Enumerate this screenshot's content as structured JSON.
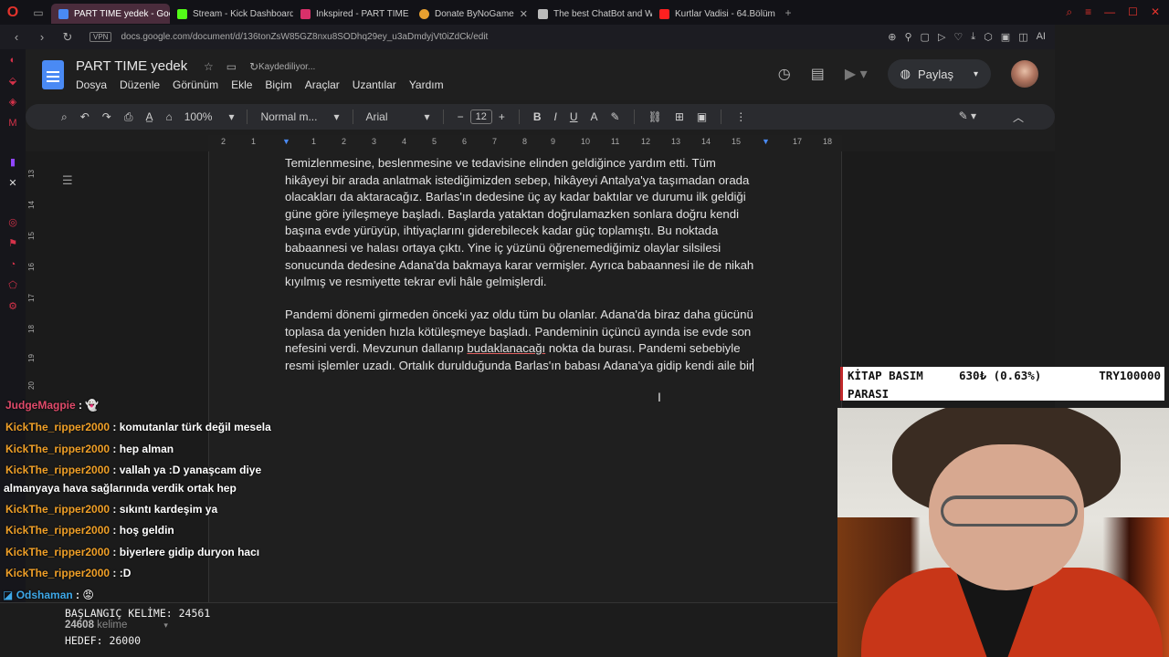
{
  "browser": {
    "tabs": [
      {
        "label": "PART TIME yedek - Goog",
        "color": "#4a8af4",
        "active": true
      },
      {
        "label": "Stream - Kick Dashboard",
        "color": "#53fc18",
        "active": false
      },
      {
        "label": "Inkspired - PART TIME",
        "color": "#d9306a",
        "active": false
      },
      {
        "label": "Donate ByNoGame",
        "color": "#e8a030",
        "active": false
      },
      {
        "label": "The best ChatBot and Wid",
        "color": "#bbbbbb",
        "active": false
      },
      {
        "label": "Kurtlar Vadisi - 64.Bölüm",
        "color": "#ff2020",
        "active": false
      }
    ],
    "url": "docs.google.com/document/d/136tonZsW85GZ8nxu8SODhq29ey_u3aDmdyjVt0iZdCk/edit",
    "vpn_label": "VPN",
    "ai_label": "AI"
  },
  "docs": {
    "title": "PART TIME  yedek",
    "saving_status": "Kaydediliyor...",
    "menu": [
      "Dosya",
      "Düzenle",
      "Görünüm",
      "Ekle",
      "Biçim",
      "Araçlar",
      "Uzantılar",
      "Yardım"
    ],
    "share_label": "Paylaş",
    "toolbar": {
      "zoom": "100%",
      "style": "Normal m...",
      "font": "Arial",
      "font_size": "12"
    },
    "ruler_h": [
      "2",
      "1",
      "1",
      "2",
      "3",
      "4",
      "5",
      "6",
      "7",
      "8",
      "9",
      "10",
      "11",
      "12",
      "13",
      "14",
      "15",
      "16",
      "17",
      "18"
    ],
    "ruler_v": [
      "13",
      "14",
      "15",
      "16",
      "17",
      "18",
      "19",
      "20"
    ],
    "paragraph1": "Temizlenmesine, beslenmesine ve tedavisine elinden geldiğince yardım etti. Tüm hikâyeyi bir arada anlatmak istediğimizden sebep, hikâyeyi Antalya'ya taşımadan orada olacakları da aktaracağız. Barlas'ın dedesine üç ay kadar baktılar ve durumu ilk geldiği güne göre iyileşmeye başladı. Başlarda yataktan doğrulamazken sonlara doğru kendi başına evde yürüyüp, ihtiyaçlarını giderebilecek kadar güç toplamıştı. Bu noktada babaannesi ve halası ortaya çıktı. Yine iç yüzünü öğrenemediğimiz olaylar silsilesi sonucunda dedesine Adana'da bakmaya karar vermişler. Ayrıca babaannesi ile de nikah kıyılmış ve resmiyette tekrar evli hâle gelmişlerdi.",
    "paragraph2_a": "Pandemi dönemi girmeden önceki yaz oldu tüm bu olanlar. Adana'da biraz daha gücünü toplasa da yeniden hızla kötüleşmeye başladı. Pandeminin üçüncü ayında ise evde son nefesini verdi. Mevzunun dallanıp ",
    "paragraph2_spell": "budaklanacağı",
    "paragraph2_b": " nokta da burası. Pandemi sebebiyle resmi işlemler uzadı. Ortalık durulduğunda Barlas'ın babası Adana'ya gidip kendi aile bir"
  },
  "chat": [
    {
      "user": "JudgeMagpie",
      "message": "",
      "emote": "ghost",
      "user_color": "pink"
    },
    {
      "user": "KickThe_ripper2000",
      "message": "komutanlar türk değil mesela"
    },
    {
      "user": "KickThe_ripper2000",
      "message": "hep alman"
    },
    {
      "user": "KickThe_ripper2000",
      "message": "vallah ya :D yanaşcam diye",
      "continuation": "almanyaya hava sağlarınıda verdik ortak hep"
    },
    {
      "user": "KickThe_ripper2000",
      "message": "sıkıntı kardeşim ya"
    },
    {
      "user": "KickThe_ripper2000",
      "message": "hoş geldin"
    },
    {
      "user": "KickThe_ripper2000",
      "message": "biyerlere gidip duryon hacı"
    },
    {
      "user": "KickThe_ripper2000",
      "message": ":D"
    },
    {
      "user": "Odshaman",
      "message": "",
      "emote": "angry",
      "user_color": "blue"
    }
  ],
  "word_counter": {
    "start_label": "BAŞLANGIÇ KELİME: 24561",
    "current_count": "24608",
    "current_suffix": " kelime",
    "target_label": "HEDEF: 26000"
  },
  "ticker": {
    "label_line1": "KİTAP BASIM",
    "label_line2": "PARASI",
    "raised": "630₺ (0.63%)",
    "goal": "TRY100000"
  }
}
